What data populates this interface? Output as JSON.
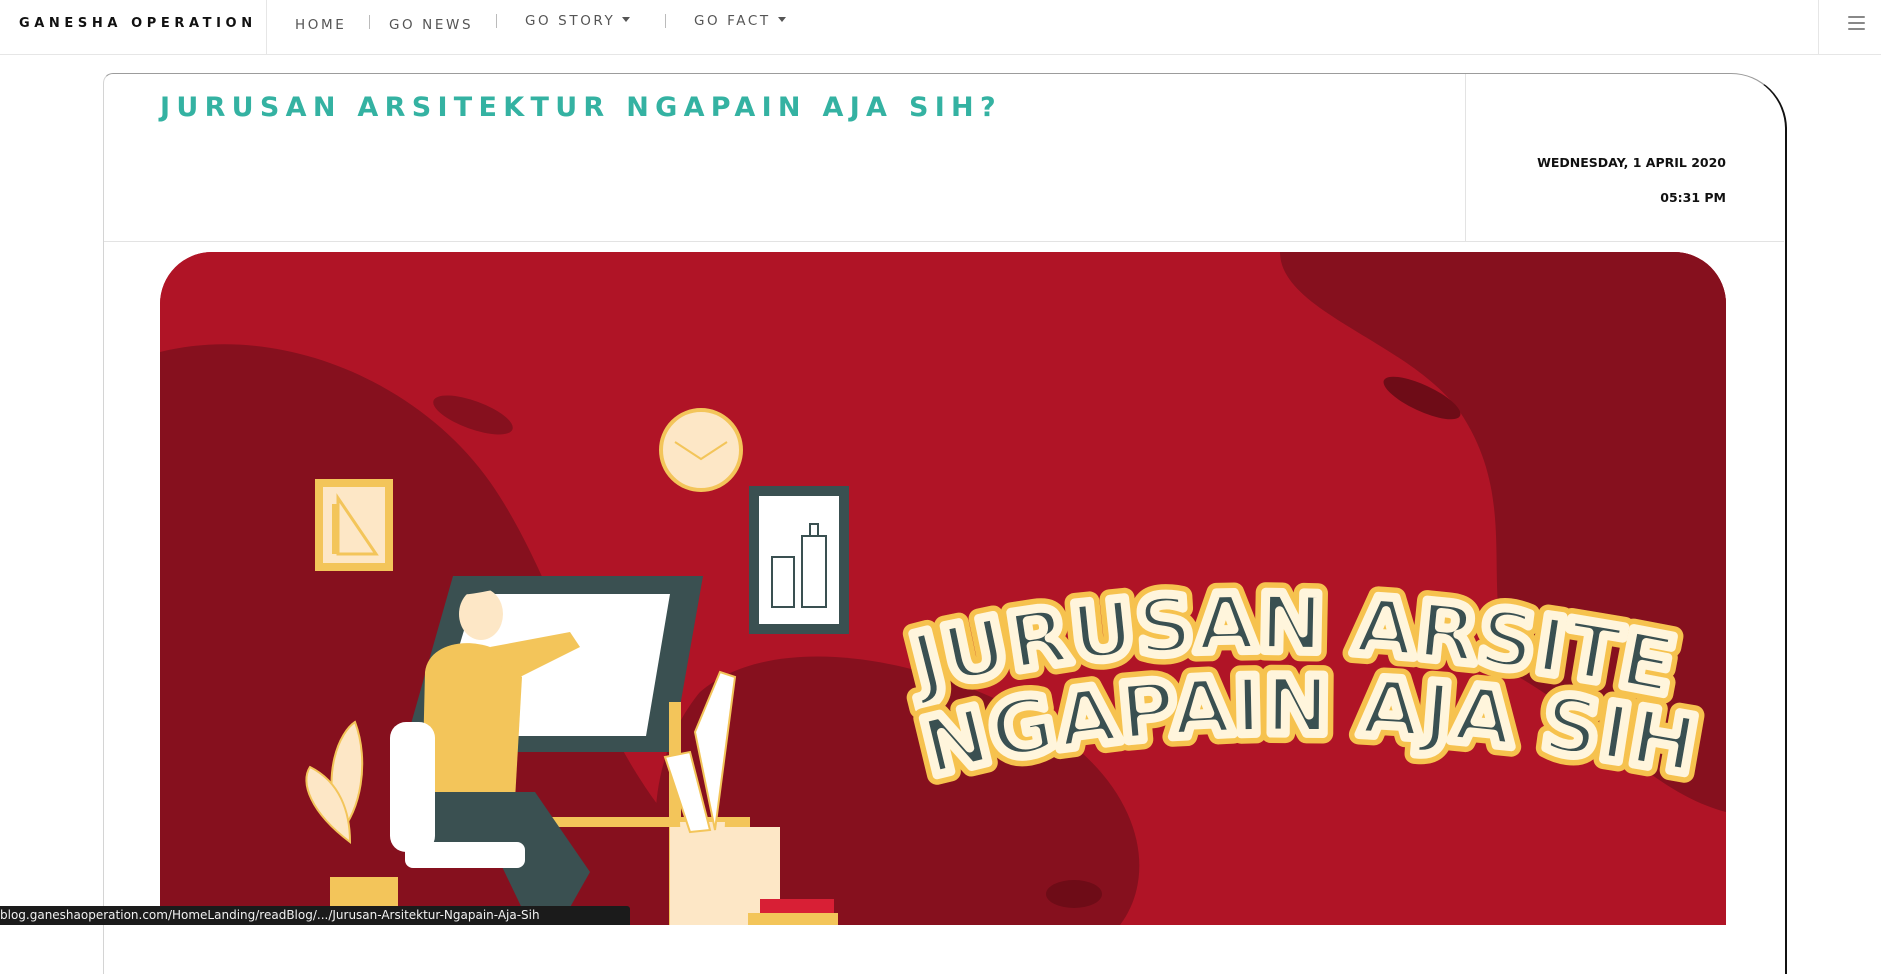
{
  "navbar": {
    "brand": "GANESHA OPERATION",
    "links": [
      {
        "label": "HOME",
        "dropdown": false
      },
      {
        "label": "GO NEWS",
        "dropdown": false
      },
      {
        "label": "GO STORY",
        "dropdown": true
      },
      {
        "label": "GO FACT",
        "dropdown": true
      }
    ],
    "menu_icon": "hamburger-menu-icon"
  },
  "article": {
    "title": "JURUSAN ARSITEKTUR NGAPAIN AJA SIH?",
    "date": "WEDNESDAY, 1 APRIL 2020",
    "time": "05:31 PM"
  },
  "hero": {
    "headline_line1": "JURUSAN ARSITEK,",
    "headline_line2": "NGAPAIN AJA SIH?",
    "colors": {
      "background": "#b01426",
      "shadow_blob": "#86101e",
      "headline_fill": "#3a5051",
      "headline_outline": "#f6c24e",
      "accent_yellow": "#f3c55a"
    }
  },
  "statusbar": {
    "url": "blog.ganeshaoperation.com/HomeLanding/readBlog/.../Jurusan-Arsitektur-Ngapain-Aja-Sih"
  },
  "colors": {
    "title_teal": "#34b2a2"
  }
}
